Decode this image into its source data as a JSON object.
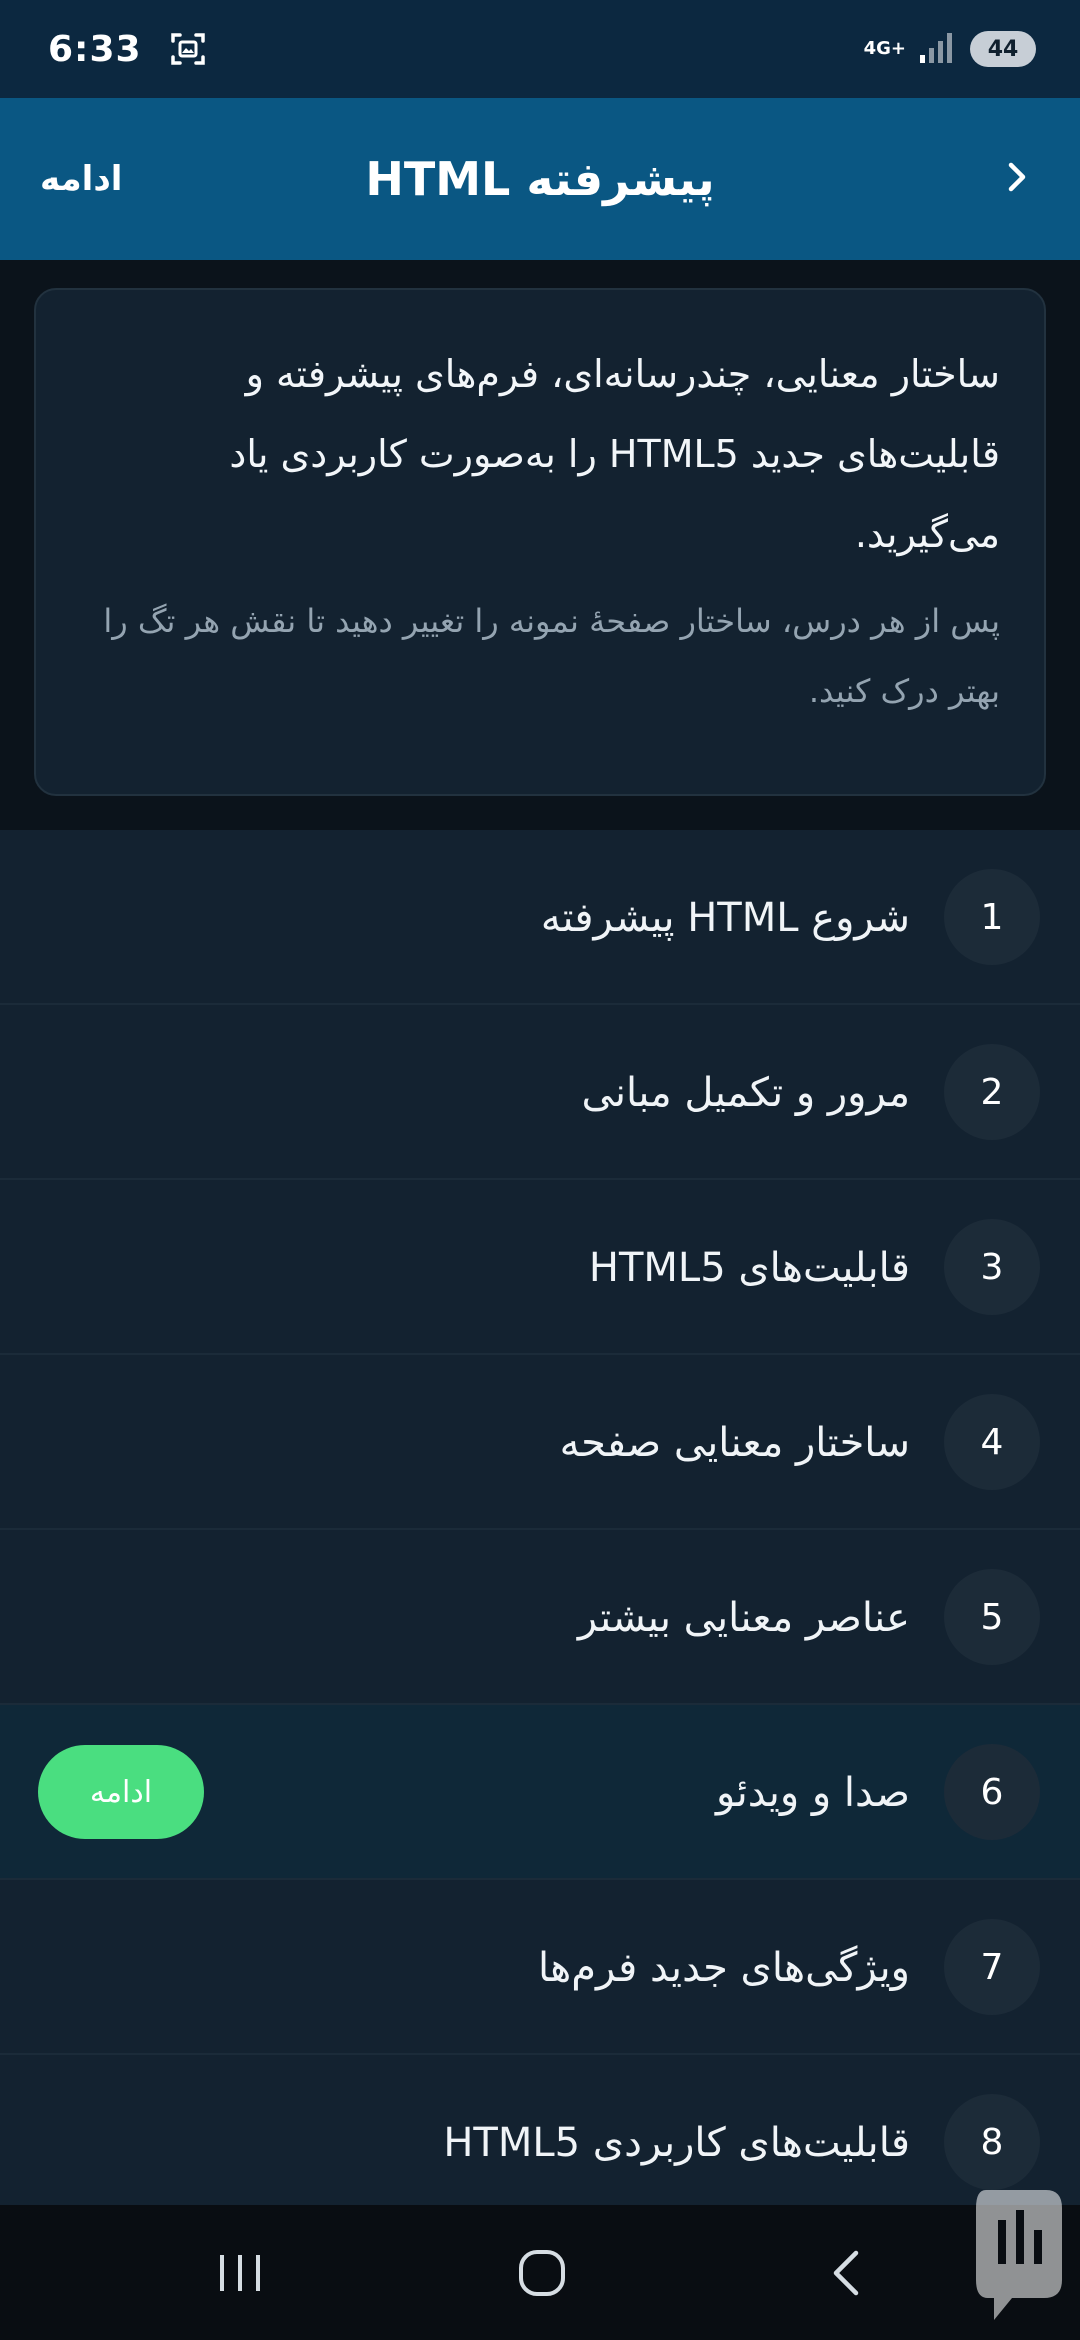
{
  "status_bar": {
    "time": "6:33",
    "network": "4G+",
    "battery": "44"
  },
  "app_bar": {
    "title": "HTML پیشرفته",
    "continue_label": "ادامه",
    "back_icon": "chevron-right-icon"
  },
  "intro": {
    "main_text": "ساختار معنایی، چندرسانه‌ای، فرم‌های پیشرفته و قابلیت‌های جدید HTML5 را به‌صورت کاربردی یاد می‌گیرید.",
    "sub_text": "پس از هر درس، ساختار صفحهٔ نمونه را تغییر دهید تا نقش هر تگ را بهتر درک کنید."
  },
  "lessons": [
    {
      "number": "1",
      "title": "شروع HTML پیشرفته"
    },
    {
      "number": "2",
      "title": "مرور و تکمیل مبانی"
    },
    {
      "number": "3",
      "title": "قابلیت‌های HTML5"
    },
    {
      "number": "4",
      "title": "ساختار معنایی صفحه"
    },
    {
      "number": "5",
      "title": "عناصر معنایی بیشتر"
    },
    {
      "number": "6",
      "title": "صدا و ویدئو",
      "continue_label": "ادامه"
    },
    {
      "number": "7",
      "title": "ویژگی‌های جدید فرم‌ها"
    },
    {
      "number": "8",
      "title": "قابلیت‌های کاربردی HTML5"
    }
  ],
  "colors": {
    "app_bar": "#0a5783",
    "status_bar": "#0c2840",
    "list_bg": "#132230",
    "active_row": "#0f2838",
    "accent_green": "#4ade80"
  }
}
